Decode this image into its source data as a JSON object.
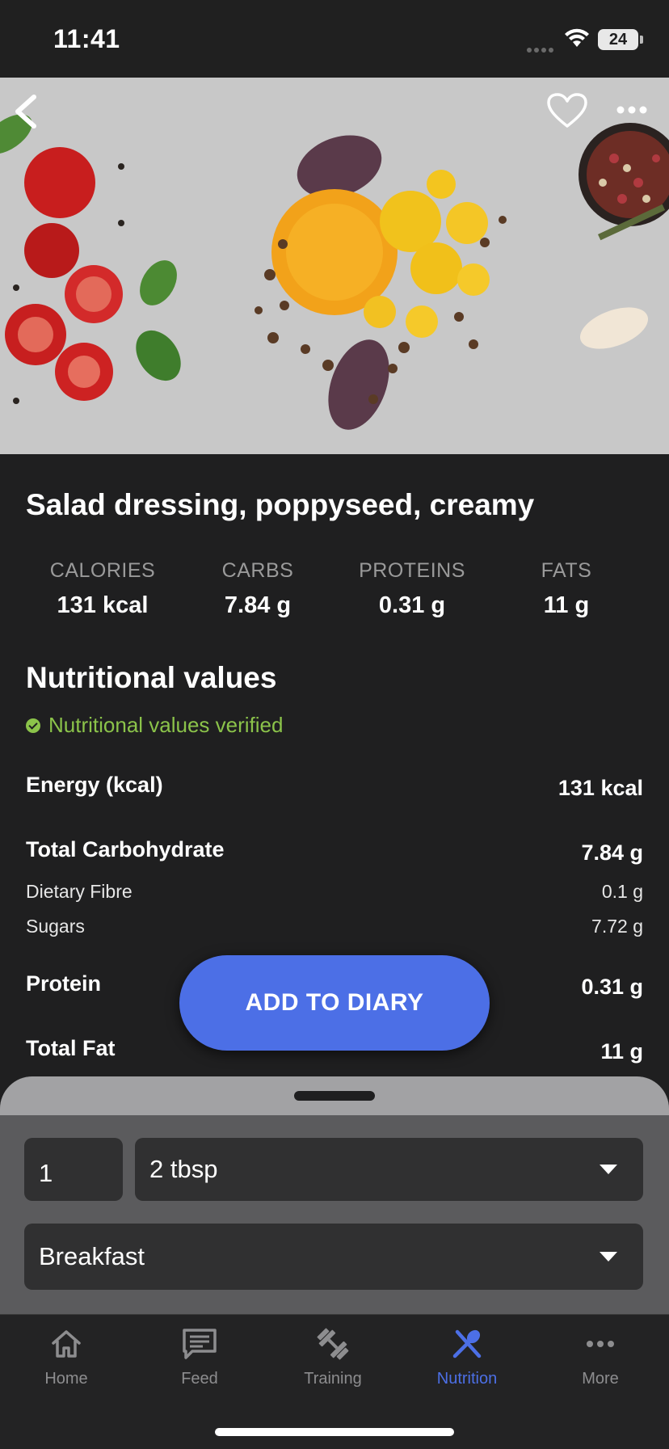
{
  "status_bar": {
    "time": "11:41",
    "battery": "24"
  },
  "food": {
    "title": "Salad dressing, poppyseed, creamy"
  },
  "macros": [
    {
      "label": "CALORIES",
      "value": "131 kcal"
    },
    {
      "label": "CARBS",
      "value": "7.84 g"
    },
    {
      "label": "PROTEINS",
      "value": "0.31 g"
    },
    {
      "label": "FATS",
      "value": "11 g"
    }
  ],
  "nutrition": {
    "title": "Nutritional values",
    "verified": "Nutritional values verified",
    "rows": [
      {
        "label": "Energy (kcal)",
        "value": "131 kcal"
      },
      {
        "label": "Total Carbohydrate",
        "value": "7.84 g"
      },
      {
        "label": "Dietary Fibre",
        "value": "0.1 g"
      },
      {
        "label": "Sugars",
        "value": "7.72 g"
      },
      {
        "label": "Protein",
        "value": "0.31 g"
      },
      {
        "label": "Total Fat",
        "value": "11 g"
      }
    ]
  },
  "add_button": "ADD TO DIARY",
  "sheet": {
    "quantity": "1",
    "unit": "2 tbsp",
    "meal": "Breakfast"
  },
  "tabs": [
    {
      "label": "Home",
      "icon": "home-icon"
    },
    {
      "label": "Feed",
      "icon": "feed-icon"
    },
    {
      "label": "Training",
      "icon": "dumbbell-icon"
    },
    {
      "label": "Nutrition",
      "icon": "utensils-icon",
      "active": true
    },
    {
      "label": "More",
      "icon": "more-icon"
    }
  ],
  "colors": {
    "accent": "#4c6fe6",
    "verified": "#8bc34a",
    "background": "#1f1f20"
  }
}
